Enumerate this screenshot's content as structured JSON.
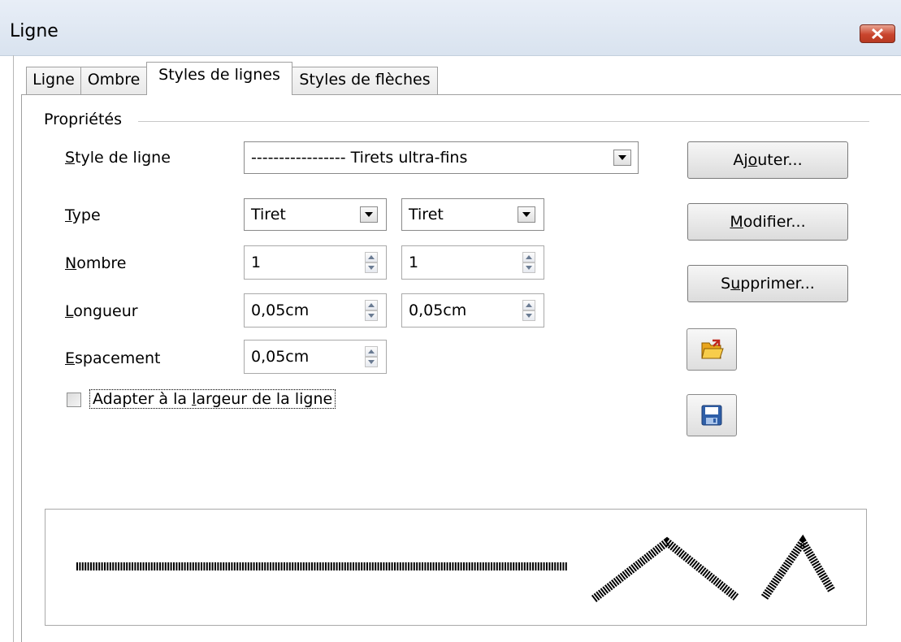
{
  "window": {
    "title": "Ligne"
  },
  "tabs": [
    {
      "label": "Ligne"
    },
    {
      "label": "Ombre"
    },
    {
      "label": "Styles de lignes",
      "active": true
    },
    {
      "label": "Styles de flèches"
    }
  ],
  "properties": {
    "legend": "Propriétés",
    "line_style": {
      "label_mn": "S",
      "label_rest": "tyle de ligne",
      "value": "----------------- Tirets ultra-fins"
    },
    "type": {
      "label_mn": "T",
      "label_rest": "ype",
      "value1": "Tiret",
      "value2": "Tiret"
    },
    "number": {
      "label_mn": "N",
      "label_rest": "ombre",
      "value1": "1",
      "value2": "1"
    },
    "length": {
      "label_mn": "L",
      "label_rest": "ongueur",
      "value1": "0,05cm",
      "value2": "0,05cm"
    },
    "spacing": {
      "label_mn": "E",
      "label_rest": "spacement",
      "value": "0,05cm"
    },
    "fit_width": {
      "label_pre": "Adapter à la ",
      "label_mn": "l",
      "label_rest": "argeur de la ligne",
      "checked": false
    }
  },
  "buttons": {
    "add": {
      "pre": "Aj",
      "mn": "o",
      "post": "uter..."
    },
    "modify": {
      "pre": "",
      "mn": "M",
      "post": "odifier..."
    },
    "delete": {
      "pre": "S",
      "mn": "u",
      "post": "pprimer..."
    },
    "load_icon": "folder-open-icon",
    "save_icon": "floppy-save-icon"
  },
  "colors": {
    "titlebar": "#dce6f2",
    "close_button": "#c9442d",
    "preview_line": "#000000"
  }
}
